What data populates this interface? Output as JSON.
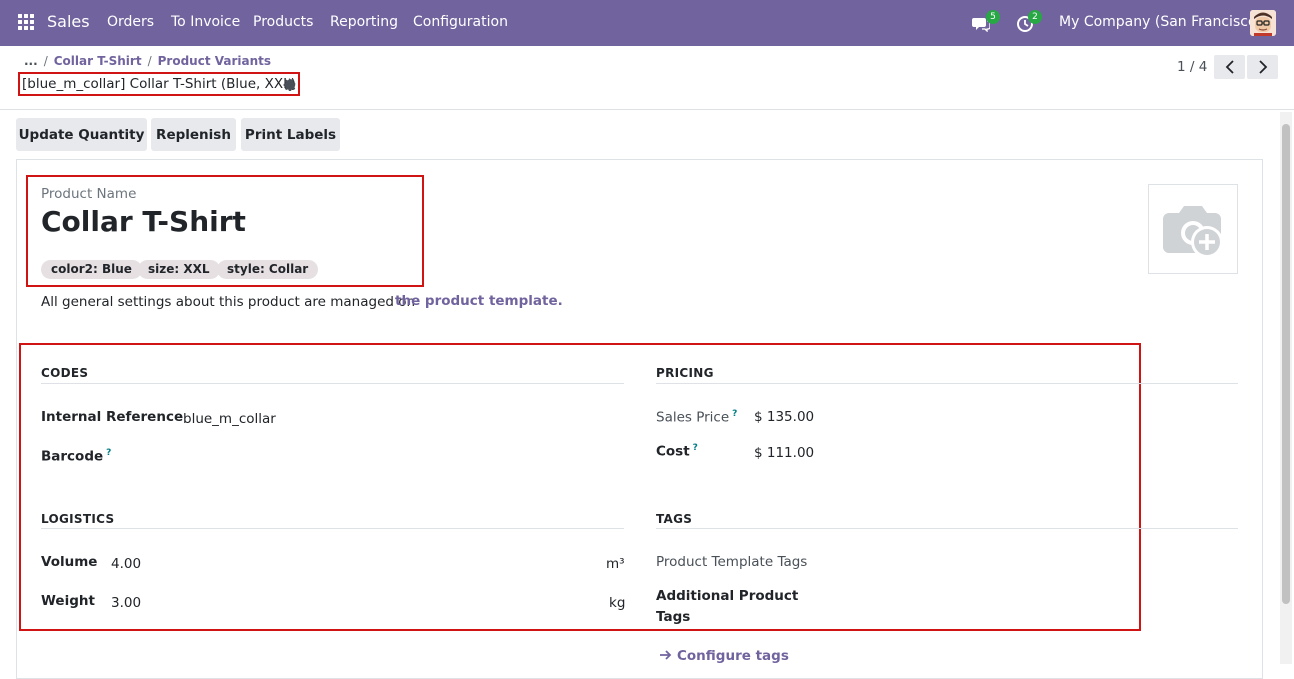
{
  "navbar": {
    "brand": "Sales",
    "menus": [
      "Orders",
      "To Invoice",
      "Products",
      "Reporting",
      "Configuration"
    ],
    "messages_count": "5",
    "activities_count": "2",
    "company": "My Company (San Francisco)"
  },
  "breadcrumb": {
    "ellipsis": "...",
    "sep": "/",
    "items": [
      "Collar T-Shirt",
      "Product Variants"
    ]
  },
  "record_title": "[blue_m_collar] Collar T-Shirt (Blue, XXL)",
  "pager": {
    "value": "1 / 4"
  },
  "actions": [
    "Update Quantity",
    "Replenish",
    "Print Labels"
  ],
  "product": {
    "name_label": "Product Name",
    "name": "Collar T-Shirt",
    "tags": [
      "color2: Blue",
      "size: XXL",
      "style: Collar"
    ],
    "info_text": "All general settings about this product are managed on",
    "info_link": "the product template."
  },
  "codes": {
    "heading": "CODES",
    "internal_ref_label": "Internal Reference",
    "internal_ref_value": "blue_m_collar",
    "barcode_label": "Barcode",
    "help_mark": "?"
  },
  "pricing": {
    "heading": "PRICING",
    "sales_price_label": "Sales Price",
    "sales_price_value": "$ 135.00",
    "cost_label": "Cost",
    "cost_value": "$ 111.00"
  },
  "logistics": {
    "heading": "LOGISTICS",
    "volume_label": "Volume",
    "volume_value": "4.00",
    "volume_unit": "m³",
    "weight_label": "Weight",
    "weight_value": "3.00",
    "weight_unit": "kg"
  },
  "tags_section": {
    "heading": "TAGS",
    "template_tags_label": "Product Template Tags",
    "additional_tags_label_1": "Additional Product",
    "additional_tags_label_2": "Tags",
    "configure_link": "Configure tags"
  },
  "icons": [
    "apps-grid-icon",
    "chat-icon",
    "activity-clock-icon",
    "user-avatar-icon",
    "gear-icon",
    "chevron-left-icon",
    "chevron-right-icon",
    "camera-add-icon",
    "arrow-right-icon"
  ],
  "colors": {
    "brand": "#71639e",
    "badge": "#28a745",
    "highlight": "#d01414"
  }
}
